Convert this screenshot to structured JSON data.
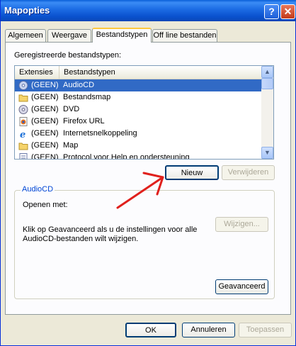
{
  "window": {
    "title": "Mapopties"
  },
  "titlebar": {
    "help_glyph": "?",
    "close_glyph": "✕"
  },
  "tabs": [
    {
      "label": "Algemeen",
      "active": false
    },
    {
      "label": "Weergave",
      "active": false
    },
    {
      "label": "Bestandstypen",
      "active": true
    },
    {
      "label": "Off line bestanden",
      "active": false
    }
  ],
  "registered_label": "Geregistreerde bestandstypen:",
  "list": {
    "columns": [
      "Extensies",
      "Bestandstypen"
    ],
    "rows": [
      {
        "ext": "(GEEN)",
        "type": "AudioCD",
        "icon": "cd-icon",
        "selected": true
      },
      {
        "ext": "(GEEN)",
        "type": "Bestandsmap",
        "icon": "folder-icon",
        "selected": false
      },
      {
        "ext": "(GEEN)",
        "type": "DVD",
        "icon": "cd-icon",
        "selected": false
      },
      {
        "ext": "(GEEN)",
        "type": "Firefox URL",
        "icon": "firefox-icon",
        "selected": false
      },
      {
        "ext": "(GEEN)",
        "type": "Internetsnelkoppeling",
        "icon": "ie-icon",
        "selected": false
      },
      {
        "ext": "(GEEN)",
        "type": "Map",
        "icon": "folder-icon",
        "selected": false
      },
      {
        "ext": "(GEEN)",
        "type": "Protocol voor Help en ondersteuning",
        "icon": "doc-icon",
        "selected": false
      }
    ]
  },
  "buttons": {
    "nieuw": "Nieuw",
    "verwijderen": "Verwijderen",
    "wijzigen": "Wijzigen...",
    "geavanceerd": "Geavanceerd",
    "ok": "OK",
    "annuleren": "Annuleren",
    "toepassen": "Toepassen"
  },
  "details": {
    "group_title": "AudioCD",
    "open_with": "Openen met:",
    "description_line1": "Klik op Geavanceerd als u de instellingen voor alle",
    "description_line2": "AudioCD-bestanden wilt wijzigen."
  },
  "colors": {
    "titlebar": "#0b53d0",
    "selection": "#316ac5",
    "group_title": "#0046d5",
    "annotation_arrow": "#e0201c"
  }
}
